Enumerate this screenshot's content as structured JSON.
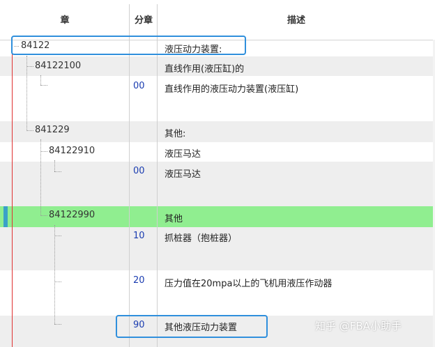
{
  "columns": {
    "chapter": "章",
    "subchapter": "分章",
    "description": "描述"
  },
  "rows": [
    {
      "code": "84122",
      "sub": "",
      "desc": "液压动力装置:"
    },
    {
      "code": "84122100",
      "sub": "",
      "desc": "直线作用(液压缸)的"
    },
    {
      "code": "",
      "sub": "00",
      "desc": "直线作用的液压动力装置(液压缸)"
    },
    {
      "code": "841229",
      "sub": "",
      "desc": "其他:"
    },
    {
      "code": "84122910",
      "sub": "",
      "desc": "液压马达"
    },
    {
      "code": "",
      "sub": "00",
      "desc": "液压马达"
    },
    {
      "code": "84122990",
      "sub": "",
      "desc": "其他"
    },
    {
      "code": "",
      "sub": "10",
      "desc": "抓桩器（抱桩器）"
    },
    {
      "code": "",
      "sub": "20",
      "desc": "压力值在20mpa以上的飞机用液压作动器"
    },
    {
      "code": "",
      "sub": "90",
      "desc": "其他液压动力装置"
    }
  ],
  "watermark": "知乎 @FBA小助手",
  "colors": {
    "highlight_row": "#90ee90",
    "callout_box": "#2f8fdc",
    "tree_line_red": "#e03030",
    "code_blue": "#1a3cb0"
  }
}
